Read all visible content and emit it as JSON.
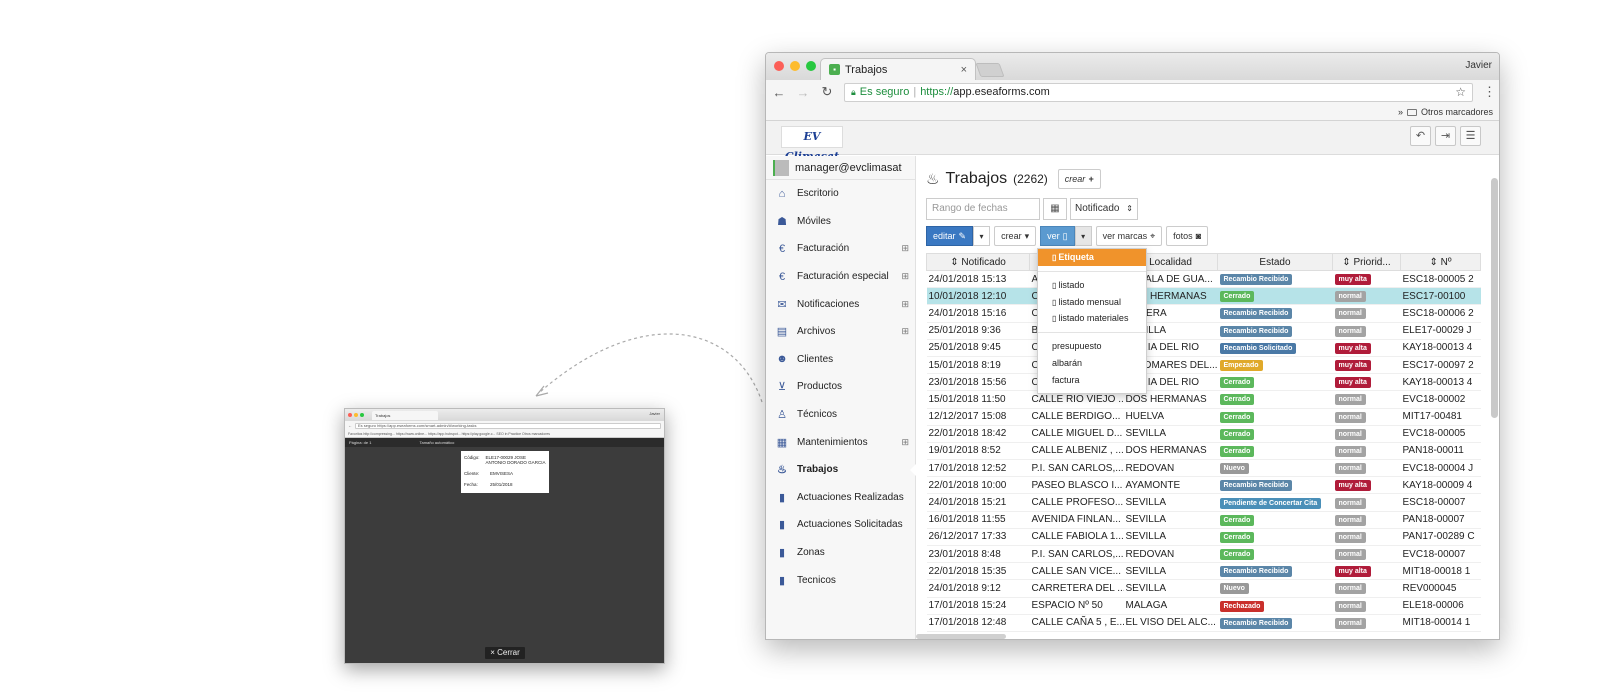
{
  "mini": {
    "tab_title": "Trabajos",
    "user": "Javier",
    "address": "Es seguro  https://app.eseaforms.com/smart-admin/#/working-tasks",
    "bookmarks": "Favoritos  http://compressing...  https://www.online...  https://app.hubspot...  https://play.google.c...  SEO in Practice  Otros marcadores",
    "toolbar_left": "Página:   de 1",
    "toolbar_center": "Tamaño automático",
    "label": {
      "codigo_key": "Código:",
      "codigo_val": "ELE17-00029 JOSE ANTONIO DORADO GARCIA",
      "cliente_key": "Cliente:",
      "cliente_val": "EMVISESA",
      "fecha_key": "Fecha:",
      "fecha_val": "25/01/2018"
    },
    "close_label": "× Cerrar"
  },
  "browser": {
    "tab_title": "Trabajos",
    "tab_close": "×",
    "profile": "Javier",
    "secure_label": "Es seguro",
    "url_scheme": "https://",
    "url_host": "app.eseaforms.com",
    "bookmarks_chevron": "»",
    "bookmarks_folder": "Otros marcadores"
  },
  "sidebar": {
    "user": "manager@evclimasat",
    "items": [
      {
        "label": "Escritorio",
        "icon": "home-icon",
        "glyph": "⌂",
        "plus": ""
      },
      {
        "label": "Móviles",
        "icon": "android-icon",
        "glyph": "☗",
        "plus": ""
      },
      {
        "label": "Facturación",
        "icon": "euro-icon",
        "glyph": "€",
        "plus": "⊞"
      },
      {
        "label": "Facturación especial",
        "icon": "euro-icon",
        "glyph": "€",
        "plus": "⊞"
      },
      {
        "label": "Notificaciones",
        "icon": "envelope-icon",
        "glyph": "✉",
        "plus": "⊞"
      },
      {
        "label": "Archivos",
        "icon": "book-icon",
        "glyph": "▤",
        "plus": "⊞"
      },
      {
        "label": "Clientes",
        "icon": "users-icon",
        "glyph": "☻",
        "plus": ""
      },
      {
        "label": "Productos",
        "icon": "cart-icon",
        "glyph": "⊻",
        "plus": ""
      },
      {
        "label": "Técnicos",
        "icon": "person-icon",
        "glyph": "♙",
        "plus": ""
      },
      {
        "label": "Mantenimientos",
        "icon": "calendar-icon",
        "glyph": "▦",
        "plus": "⊞"
      },
      {
        "label": "Trabajos",
        "icon": "extinguisher-icon",
        "glyph": "♨",
        "plus": ""
      },
      {
        "label": "Actuaciones Realizadas",
        "icon": "file-icon",
        "glyph": "▮",
        "plus": ""
      },
      {
        "label": "Actuaciones Solicitadas",
        "icon": "file-icon",
        "glyph": "▮",
        "plus": ""
      },
      {
        "label": "Zonas",
        "icon": "file-icon",
        "glyph": "▮",
        "plus": ""
      },
      {
        "label": "Tecnicos",
        "icon": "file-icon",
        "glyph": "▮",
        "plus": ""
      }
    ]
  },
  "main": {
    "title": "Trabajos",
    "count": "(2262)",
    "create_label": "crear",
    "date_placeholder": "Rango de fechas",
    "status_filter": "Notificado",
    "actions": {
      "edit": "editar",
      "create": "crear",
      "view": "ver",
      "marks": "ver marcas",
      "photos": "fotos"
    }
  },
  "dropdown": {
    "items": [
      {
        "label": "Etiqueta",
        "doc": true,
        "active": true
      },
      {
        "divider": true
      },
      {
        "label": "listado",
        "doc": true
      },
      {
        "label": "listado mensual",
        "doc": true
      },
      {
        "label": "listado materiales",
        "doc": true
      },
      {
        "divider": true
      },
      {
        "label": "presupuesto",
        "doc": false
      },
      {
        "label": "albarán",
        "doc": false
      },
      {
        "label": "factura",
        "doc": false
      }
    ]
  },
  "table": {
    "headers": [
      "⇕ Notificado",
      "",
      "Localidad",
      "Estado",
      "⇕ Priorid...",
      "⇕ Nº"
    ],
    "rows": [
      [
        "24/01/2018 15:13",
        "AV...",
        "ALCALA DE GUA...",
        "Recambio Recibido",
        "muy alta",
        "ESC18-00005 2"
      ],
      [
        "10/01/2018 12:10",
        "C...",
        "DOS HERMANAS",
        "Cerrado",
        "normal",
        "ESC17-00100"
      ],
      [
        "24/01/2018 15:16",
        "C...",
        "UTRERA",
        "Recambio Recibido",
        "normal",
        "ESC18-00006 2"
      ],
      [
        "25/01/2018 9:36",
        "B...",
        "SEVILLA",
        "Recambio Recibido",
        "normal",
        "ELE17-00029 J"
      ],
      [
        "25/01/2018 9:45",
        "C...",
        "CORIA DEL RIO",
        "Recambio Solicitado",
        "muy alta",
        "KAY18-00013 4"
      ],
      [
        "15/01/2018 8:19",
        "C...",
        "PALOMARES DEL...",
        "Empezado",
        "muy alta",
        "ESC17-00097 2"
      ],
      [
        "23/01/2018 15:56",
        "C...",
        "CORIA DEL RIO",
        "Cerrado",
        "muy alta",
        "KAY18-00013 4"
      ],
      [
        "15/01/2018 11:50",
        "CALLE RIO VIEJO ...",
        "DOS HERMANAS",
        "Cerrado",
        "normal",
        "EVC18-00002"
      ],
      [
        "12/12/2017 15:08",
        "CALLE BERDIGO...",
        "HUELVA",
        "Cerrado",
        "normal",
        "MIT17-00481"
      ],
      [
        "22/01/2018 18:42",
        "CALLE MIGUEL D...",
        "SEVILLA",
        "Cerrado",
        "normal",
        "EVC18-00005"
      ],
      [
        "19/01/2018 8:52",
        "CALLE ALBENIZ , ...",
        "DOS HERMANAS",
        "Cerrado",
        "normal",
        "PAN18-00011"
      ],
      [
        "17/01/2018 12:52",
        "P.I. SAN CARLOS,...",
        "REDOVAN",
        "Nuevo",
        "normal",
        "EVC18-00004 J"
      ],
      [
        "22/01/2018 10:00",
        "PASEO BLASCO I...",
        "AYAMONTE",
        "Recambio Recibido",
        "muy alta",
        "KAY18-00009 4"
      ],
      [
        "24/01/2018 15:21",
        "CALLE PROFESO...",
        "SEVILLA",
        "Pendiente de Concertar Cita",
        "normal",
        "ESC18-00007"
      ],
      [
        "16/01/2018 11:55",
        "AVENIDA FINLAN...",
        "SEVILLA",
        "Cerrado",
        "normal",
        "PAN18-00007"
      ],
      [
        "26/12/2017 17:33",
        "CALLE FABIOLA 1...",
        "SEVILLA",
        "Cerrado",
        "normal",
        "PAN17-00289 C"
      ],
      [
        "23/01/2018 8:48",
        "P.I. SAN CARLOS,...",
        "REDOVAN",
        "Cerrado",
        "normal",
        "EVC18-00007"
      ],
      [
        "22/01/2018 15:35",
        "CALLE SAN VICE...",
        "SEVILLA",
        "Recambio Recibido",
        "muy alta",
        "MIT18-00018 1"
      ],
      [
        "24/01/2018 9:12",
        "CARRETERA DEL ...",
        "SEVILLA",
        "Nuevo",
        "normal",
        "REV000045"
      ],
      [
        "17/01/2018 15:24",
        "ESPACIO Nº 50",
        "MALAGA",
        "Rechazado",
        "normal",
        "ELE18-00006"
      ],
      [
        "17/01/2018 12:48",
        "CALLE CAÑA 5 , E...",
        "EL VISO DEL ALC...",
        "Recambio Recibido",
        "normal",
        "MIT18-00014 1"
      ]
    ],
    "highlight_row": 1
  },
  "colors": {
    "estado": {
      "Recambio Recibido": "#5b86a8",
      "Cerrado": "#5cb85c",
      "Recambio Solicitado": "#4a79a6",
      "Empezado": "#e0a92a",
      "Nuevo": "#999999",
      "Pendiente de Concertar Cita": "#4a8fb8",
      "Rechazado": "#c9302c"
    },
    "prioridad": {
      "muy alta": "#b01c3a",
      "normal": "#a3a3a3"
    }
  }
}
